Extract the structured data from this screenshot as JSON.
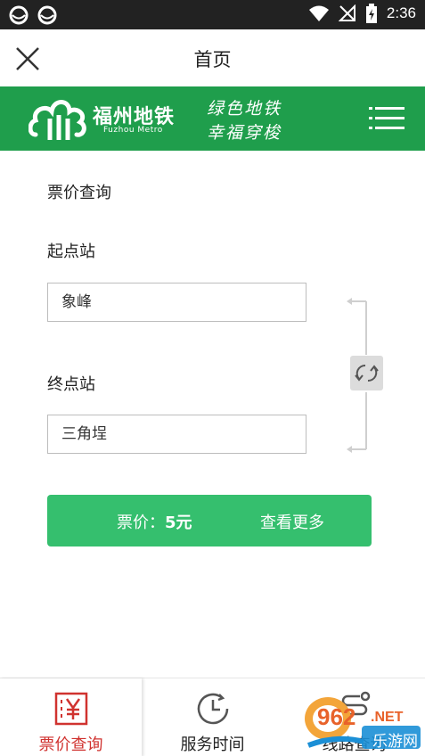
{
  "status_bar": {
    "time": "2:36",
    "icons": [
      "app-notification-icon",
      "app-notification-icon",
      "wifi-icon",
      "no-signal-icon",
      "battery-charging-icon"
    ]
  },
  "header": {
    "title": "首页",
    "close_icon": "close-icon"
  },
  "banner": {
    "logo_cn": "福州地铁",
    "logo_en": "Fuzhou Metro",
    "slogan_line1": "绿色地铁",
    "slogan_line2": "幸福穿梭",
    "menu_icon": "hamburger-menu-icon",
    "color": "#1f9e4c"
  },
  "fare_query": {
    "section_title": "票价查询",
    "start_label": "起点站",
    "start_value": "象峰",
    "end_label": "终点站",
    "end_value": "三角埕",
    "swap_icon": "swap-icon",
    "price_label": "票价：",
    "price_value": "5元",
    "more_label": "查看更多",
    "accent_color": "#35bf6e"
  },
  "bottom_nav": {
    "items": [
      {
        "label": "票价查询",
        "icon": "ticket-yuan-icon",
        "active": true
      },
      {
        "label": "服务时间",
        "icon": "clock-icon",
        "active": false
      },
      {
        "label": "线路查询",
        "icon": "route-icon",
        "active": false
      }
    ],
    "active_color": "#d0322f"
  },
  "watermark": {
    "text_main": "962",
    "text_suffix": ".NET",
    "text_sub": "乐游网"
  }
}
